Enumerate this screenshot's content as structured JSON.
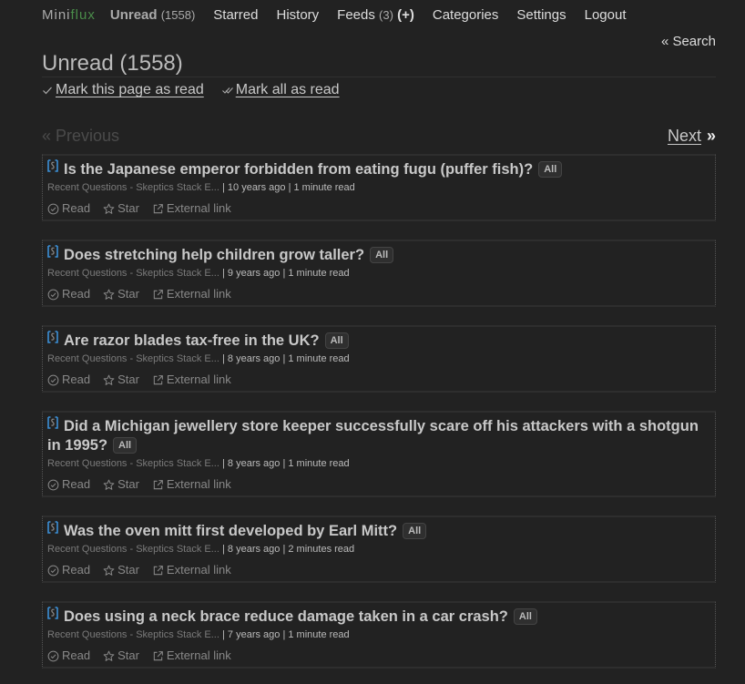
{
  "header": {
    "logo_prefix": "Mini",
    "logo_suffix": "flux",
    "nav": {
      "unread_label": "Unread",
      "unread_count": "(1558)",
      "starred_label": "Starred",
      "history_label": "History",
      "feeds_label": "Feeds",
      "feeds_count": "(3)",
      "feeds_add": "(+)",
      "categories_label": "Categories",
      "settings_label": "Settings",
      "logout_label": "Logout"
    },
    "search_link": "« Search"
  },
  "page": {
    "title": "Unread (1558)",
    "mark_page_read": "Mark this page as read",
    "mark_all_read": "Mark all as read"
  },
  "pagination": {
    "previous": "« Previous",
    "next": "Next",
    "next_arrow": "»"
  },
  "entry_actions": {
    "read": "Read",
    "star": "Star",
    "external": "External link"
  },
  "colors": {
    "background": "#222222",
    "logo_accent": "#4a8c4a",
    "feed_icon": "#3b8fd6"
  },
  "entries": [
    {
      "title": "Is the Japanese emperor forbidden from eating fugu (puffer fish)?",
      "category": "All",
      "feed": "Recent Questions - Skeptics Stack E...",
      "date": "10 years ago",
      "reading_time": "1 minute read"
    },
    {
      "title": "Does stretching help children grow taller?",
      "category": "All",
      "feed": "Recent Questions - Skeptics Stack E...",
      "date": "9 years ago",
      "reading_time": "1 minute read"
    },
    {
      "title": "Are razor blades tax-free in the UK?",
      "category": "All",
      "feed": "Recent Questions - Skeptics Stack E...",
      "date": "8 years ago",
      "reading_time": "1 minute read"
    },
    {
      "title": "Did a Michigan jewellery store keeper successfully scare off his attackers with a shotgun in 1995?",
      "category": "All",
      "feed": "Recent Questions - Skeptics Stack E...",
      "date": "8 years ago",
      "reading_time": "1 minute read"
    },
    {
      "title": "Was the oven mitt first developed by Earl Mitt?",
      "category": "All",
      "feed": "Recent Questions - Skeptics Stack E...",
      "date": "8 years ago",
      "reading_time": "2 minutes read"
    },
    {
      "title": "Does using a neck brace reduce damage taken in a car crash?",
      "category": "All",
      "feed": "Recent Questions - Skeptics Stack E...",
      "date": "7 years ago",
      "reading_time": "1 minute read"
    }
  ]
}
